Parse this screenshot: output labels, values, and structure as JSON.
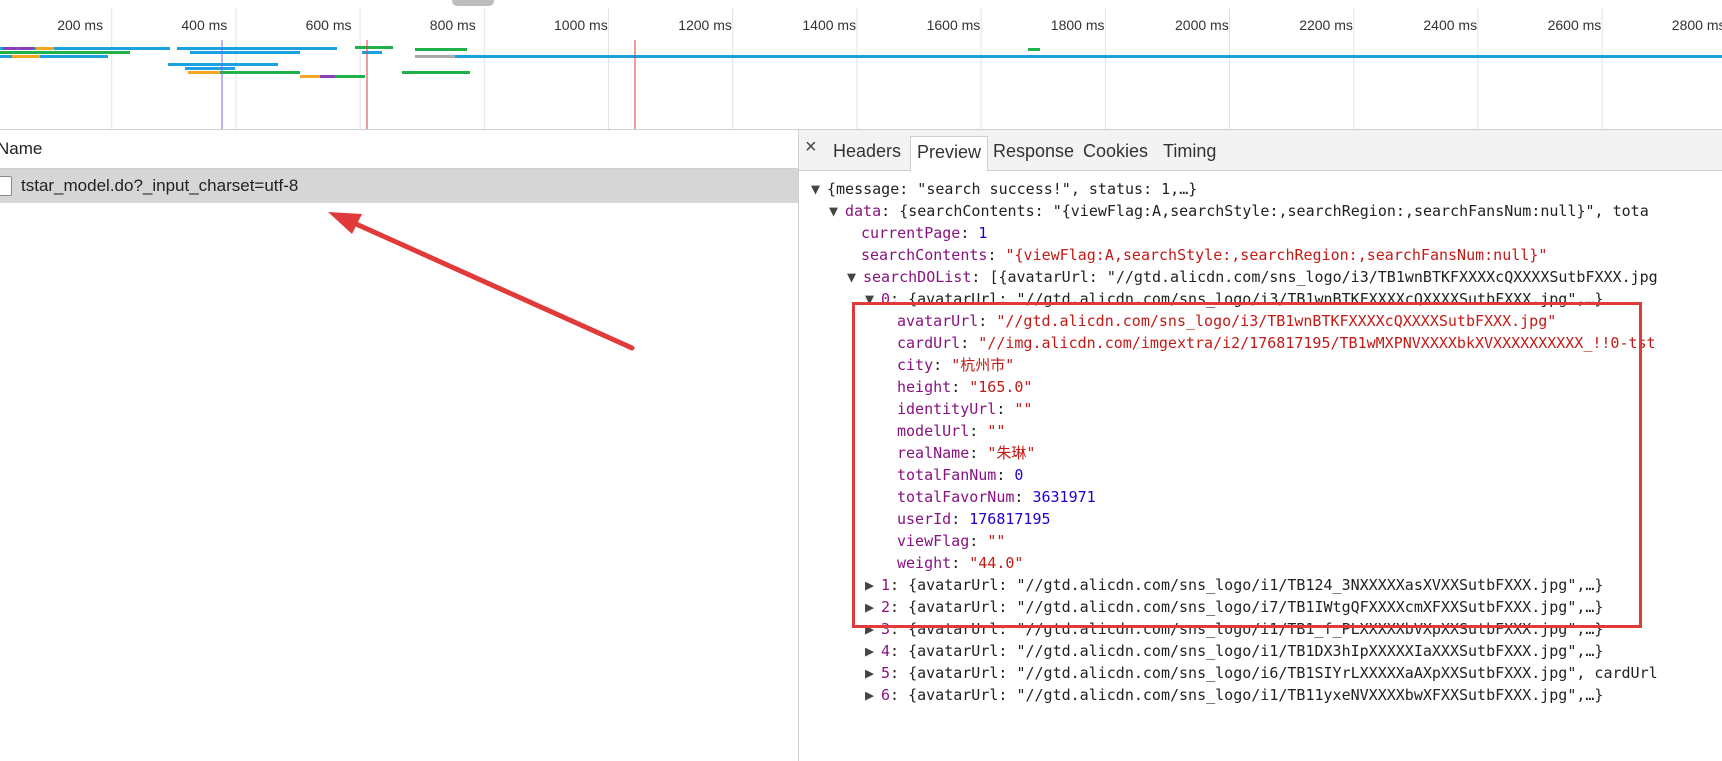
{
  "timeline": {
    "ticks": [
      "200 ms",
      "400 ms",
      "600 ms",
      "800 ms",
      "1000 ms",
      "1200 ms",
      "1400 ms",
      "1600 ms",
      "1800 ms",
      "2000 ms",
      "2200 ms",
      "2400 ms",
      "2600 ms",
      "2800 ms"
    ],
    "colors": {
      "blue": "#1ba1e2",
      "green": "#21b14b",
      "purple": "#8b3fb5",
      "orange": "#f5a623",
      "red": "#e03a3a",
      "grey": "#aaaaaa"
    }
  },
  "network": {
    "name_header": "Name",
    "request_name": "tstar_model.do?_input_charset=utf-8"
  },
  "detail_tabs": [
    "Headers",
    "Preview",
    "Response",
    "Cookies",
    "Timing"
  ],
  "active_tab": "Preview",
  "preview": {
    "root_summary": "{message: \"search success!\", status: 1,…}",
    "data_key": "data",
    "data_summary": "{searchContents: \"{viewFlag:A,searchStyle:,searchRegion:,searchFansNum:null}\", tota",
    "currentPage_key": "currentPage",
    "currentPage_val": "1",
    "searchContents_key": "searchContents",
    "searchContents_val": "\"{viewFlag:A,searchStyle:,searchRegion:,searchFansNum:null}\"",
    "searchDOList_key": "searchDOList",
    "searchDOList_summary": "[{avatarUrl: \"//gtd.alicdn.com/sns_logo/i3/TB1wnBTKFXXXXcQXXXXSutbFXXX.jpg",
    "item0_key": "0",
    "item0_summary": "{avatarUrl: \"//gtd.alicdn.com/sns_logo/i3/TB1wnBTKFXXXXcQXXXXSutbFXXX.jpg\",…}",
    "fields": [
      {
        "key": "avatarUrl",
        "val": "\"//gtd.alicdn.com/sns_logo/i3/TB1wnBTKFXXXXcQXXXXSutbFXXX.jpg\"",
        "type": "str"
      },
      {
        "key": "cardUrl",
        "val": "\"//img.alicdn.com/imgextra/i2/176817195/TB1wMXPNVXXXXbkXVXXXXXXXXXX_!!0-tst",
        "type": "str"
      },
      {
        "key": "city",
        "val": "\"杭州市\"",
        "type": "str"
      },
      {
        "key": "height",
        "val": "\"165.0\"",
        "type": "str"
      },
      {
        "key": "identityUrl",
        "val": "\"\"",
        "type": "str"
      },
      {
        "key": "modelUrl",
        "val": "\"\"",
        "type": "str"
      },
      {
        "key": "realName",
        "val": "\"朱琳\"",
        "type": "str"
      },
      {
        "key": "totalFanNum",
        "val": "0",
        "type": "num"
      },
      {
        "key": "totalFavorNum",
        "val": "3631971",
        "type": "num"
      },
      {
        "key": "userId",
        "val": "176817195",
        "type": "num"
      },
      {
        "key": "viewFlag",
        "val": "\"\"",
        "type": "str"
      },
      {
        "key": "weight",
        "val": "\"44.0\"",
        "type": "str"
      }
    ],
    "items": [
      {
        "key": "1",
        "summary": "{avatarUrl: \"//gtd.alicdn.com/sns_logo/i1/TB124_3NXXXXXasXVXXSutbFXXX.jpg\",…}"
      },
      {
        "key": "2",
        "summary": "{avatarUrl: \"//gtd.alicdn.com/sns_logo/i7/TB1IWtgQFXXXXcmXFXXSutbFXXX.jpg\",…}"
      },
      {
        "key": "3",
        "summary": "{avatarUrl: \"//gtd.alicdn.com/sns_logo/i1/TB1_f_PLXXXXXbVXpXXSutbFXXX.jpg\",…}"
      },
      {
        "key": "4",
        "summary": "{avatarUrl: \"//gtd.alicdn.com/sns_logo/i1/TB1DX3hIpXXXXXIaXXXSutbFXXX.jpg\",…}"
      },
      {
        "key": "5",
        "summary": "{avatarUrl: \"//gtd.alicdn.com/sns_logo/i6/TB1SIYrLXXXXXaAXpXXSutbFXXX.jpg\", cardUrl"
      },
      {
        "key": "6",
        "summary": "{avatarUrl: \"//gtd.alicdn.com/sns_logo/i1/TB11yxeNVXXXXbwXFXXSutbFXXX.jpg\",…}"
      }
    ]
  }
}
